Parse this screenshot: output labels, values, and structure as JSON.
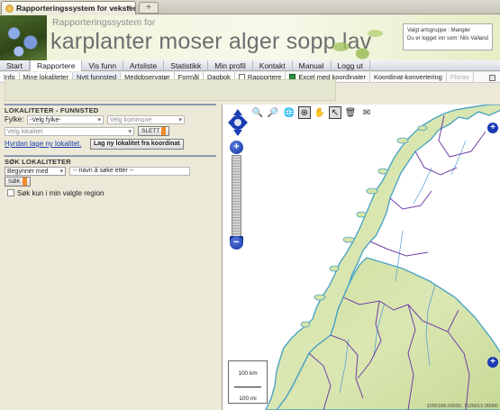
{
  "browser": {
    "tab_title": "Rapporteringssystem for vekster",
    "new_tab": "+"
  },
  "banner": {
    "subtitle": "Rapporteringssystem for",
    "title": "karplanter moser alger sopp lav",
    "login_line1": "Valgt artsgruppe : Mangler",
    "login_line2": "Du er logget inn som: Nils Valland"
  },
  "mainmenu": {
    "items": [
      "Start",
      "Rapportere",
      "Vis funn",
      "Artsliste",
      "Statistikk",
      "Min profil",
      "Kontakt",
      "Manual",
      "Logg ut"
    ],
    "active": "Rapportere"
  },
  "submenu": {
    "items": [
      "Info",
      "Mine lokaliteter",
      "Nytt funnsted",
      "Medobservatør",
      "Formål",
      "Dagbok",
      "Rapportere",
      "Excel med koordinater",
      "Koordinat-konvertering",
      "Florav"
    ]
  },
  "locations": {
    "heading": "LOKALITETER - FUNNSTED",
    "county_label": "Fylke:",
    "county_value": "-Velg fylke-",
    "municipality_value": "Velg kommune",
    "locality_value": "Velg lokalitet",
    "delete_button": "SLETT",
    "howto_link": "Hyrdan lage ny lokalitet.",
    "new_coord_button": "Lag ny lokalitet fra koordinat"
  },
  "search": {
    "heading": "SØK LOKALITETER",
    "mode_value": "Begynner med",
    "input_placeholder": "-- navn å søke etter --",
    "search_button": "SØK",
    "region_checkbox_label": "Søk kun i min valgte region",
    "region_checked": false
  },
  "map": {
    "tools": [
      "zoom-in-icon",
      "zoom-out-icon",
      "globe-icon",
      "zoom-box-icon",
      "pan-hand-icon",
      "pointer-icon",
      "delete-icon",
      "envelope-icon"
    ],
    "scale_top": "100 km",
    "scale_bottom": "100 mi",
    "coordinates": "1050188.00000, 7126012.00000",
    "colors": {
      "sea": "#ffffff",
      "land": "#d7e4a8",
      "coast": "#5ab0cc",
      "borders": "#6a3fa0"
    }
  }
}
